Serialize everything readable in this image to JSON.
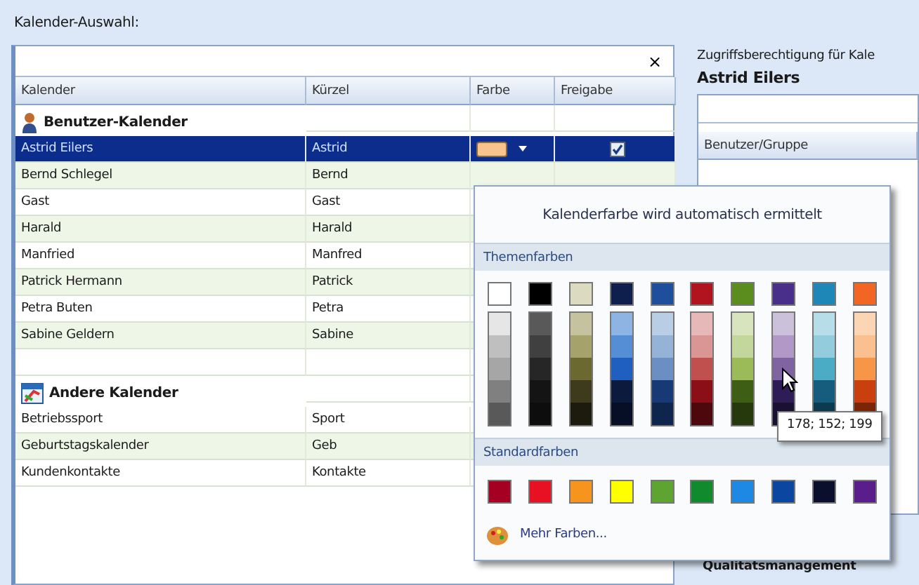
{
  "left_panel": {
    "title": "Kalender-Auswahl:",
    "filter": {
      "clear": "×"
    },
    "columns": [
      "Kalender",
      "Kürzel",
      "Farbe",
      "Freigabe"
    ],
    "groups": [
      {
        "title": "Benutzer-Kalender",
        "kind": "users",
        "rows": [
          {
            "name": "Astrid Eilers",
            "short": "Astrid",
            "selected": true,
            "color": "#f7c48e",
            "shared": true
          },
          {
            "name": "Bernd Schlegel",
            "short": "Bernd",
            "selected": false
          },
          {
            "name": "Gast",
            "short": "Gast",
            "selected": false
          },
          {
            "name": "Harald",
            "short": "Harald",
            "selected": false
          },
          {
            "name": "Manfried",
            "short": "Manfred",
            "selected": false
          },
          {
            "name": "Patrick Hermann",
            "short": "Patrick",
            "selected": false
          },
          {
            "name": "Petra Buten",
            "short": "Petra",
            "selected": false
          },
          {
            "name": "Sabine Geldern",
            "short": "Sabine",
            "selected": false
          }
        ]
      },
      {
        "title": "Andere Kalender",
        "kind": "calendars",
        "rows": [
          {
            "name": "Betriebssport",
            "short": "Sport",
            "selected": false
          },
          {
            "name": "Geburtstagskalender",
            "short": "Geb",
            "selected": false
          },
          {
            "name": "Kundenkontakte",
            "short": "Kontakte",
            "selected": false
          }
        ]
      }
    ]
  },
  "right_panel": {
    "title": "Zugriffsberechtigung für Kale",
    "calendar": "Astrid Eilers",
    "columns": [
      "Benutzer/Gruppe"
    ],
    "rows": [
      "Qualitätsmanagement"
    ]
  },
  "color_popup": {
    "auto_text": "Kalenderfarbe wird automatisch ermittelt",
    "theme_title": "Themenfarben",
    "theme_columns": [
      {
        "color": "#ffffff",
        "shades": [
          {
            "color": "#e6e6e6"
          },
          {
            "color": "#bfbfbf"
          },
          {
            "color": "#a6a6a6"
          },
          {
            "color": "#808080"
          },
          {
            "color": "#595959"
          }
        ]
      },
      {
        "color": "#000000",
        "shades": [
          {
            "color": "#595959"
          },
          {
            "color": "#404040"
          },
          {
            "color": "#262626"
          },
          {
            "color": "#141414"
          },
          {
            "color": "#0d0d0d"
          }
        ]
      },
      {
        "color": "#dddac2",
        "shades": [
          {
            "color": "#c5c2a0"
          },
          {
            "color": "#a6a26c"
          },
          {
            "color": "#6b6830"
          },
          {
            "color": "#3d3b1b"
          },
          {
            "color": "#1c1b0e"
          }
        ]
      },
      {
        "color": "#0f1f4d",
        "shades": [
          {
            "color": "#8eb4e3"
          },
          {
            "color": "#558ed5"
          },
          {
            "color": "#1f5fc0"
          },
          {
            "color": "#0b1a3d"
          },
          {
            "color": "#070f26"
          }
        ]
      },
      {
        "color": "#1f4e9c",
        "shades": [
          {
            "color": "#b9cde5"
          },
          {
            "color": "#95b3d7"
          },
          {
            "color": "#6b8fc2"
          },
          {
            "color": "#173a76"
          },
          {
            "color": "#0e254e"
          }
        ]
      },
      {
        "color": "#b0151f",
        "shades": [
          {
            "color": "#e6b9b8"
          },
          {
            "color": "#d99694"
          },
          {
            "color": "#c0504d"
          },
          {
            "color": "#8b0f17"
          },
          {
            "color": "#4d080d"
          }
        ]
      },
      {
        "color": "#5b8c1e",
        "shades": [
          {
            "color": "#d7e4bd"
          },
          {
            "color": "#c3d69b"
          },
          {
            "color": "#9bbb59"
          },
          {
            "color": "#3d5e14"
          },
          {
            "color": "#26390c"
          }
        ]
      },
      {
        "color": "#4a2f8a",
        "shades": [
          {
            "color": "#ccc1da"
          },
          {
            "color": "#b298c7"
          },
          {
            "color": "#8064a2"
          },
          {
            "color": "#2e1c57"
          },
          {
            "color": "#1a1033"
          }
        ]
      },
      {
        "color": "#1f87b8",
        "shades": [
          {
            "color": "#b7dee8"
          },
          {
            "color": "#93cddd"
          },
          {
            "color": "#4bacc6"
          },
          {
            "color": "#155c7d"
          },
          {
            "color": "#0c3a4e"
          }
        ]
      },
      {
        "color": "#f26522",
        "shades": [
          {
            "color": "#fcd5b4"
          },
          {
            "color": "#fac090"
          },
          {
            "color": "#f79646"
          },
          {
            "color": "#c93f0e"
          },
          {
            "color": "#7a2408"
          }
        ]
      }
    ],
    "standard_title": "Standardfarben",
    "standard_colors": [
      {
        "color": "#a50021"
      },
      {
        "color": "#e81123"
      },
      {
        "color": "#f7941d"
      },
      {
        "color": "#ffff00"
      },
      {
        "color": "#5ea431"
      },
      {
        "color": "#108a2c"
      },
      {
        "color": "#1e88e5"
      },
      {
        "color": "#0b46a0"
      },
      {
        "color": "#0a0f2e"
      },
      {
        "color": "#5a1e8c"
      }
    ],
    "more_colors": "Mehr Farben...",
    "tooltip": "178; 152; 199"
  }
}
